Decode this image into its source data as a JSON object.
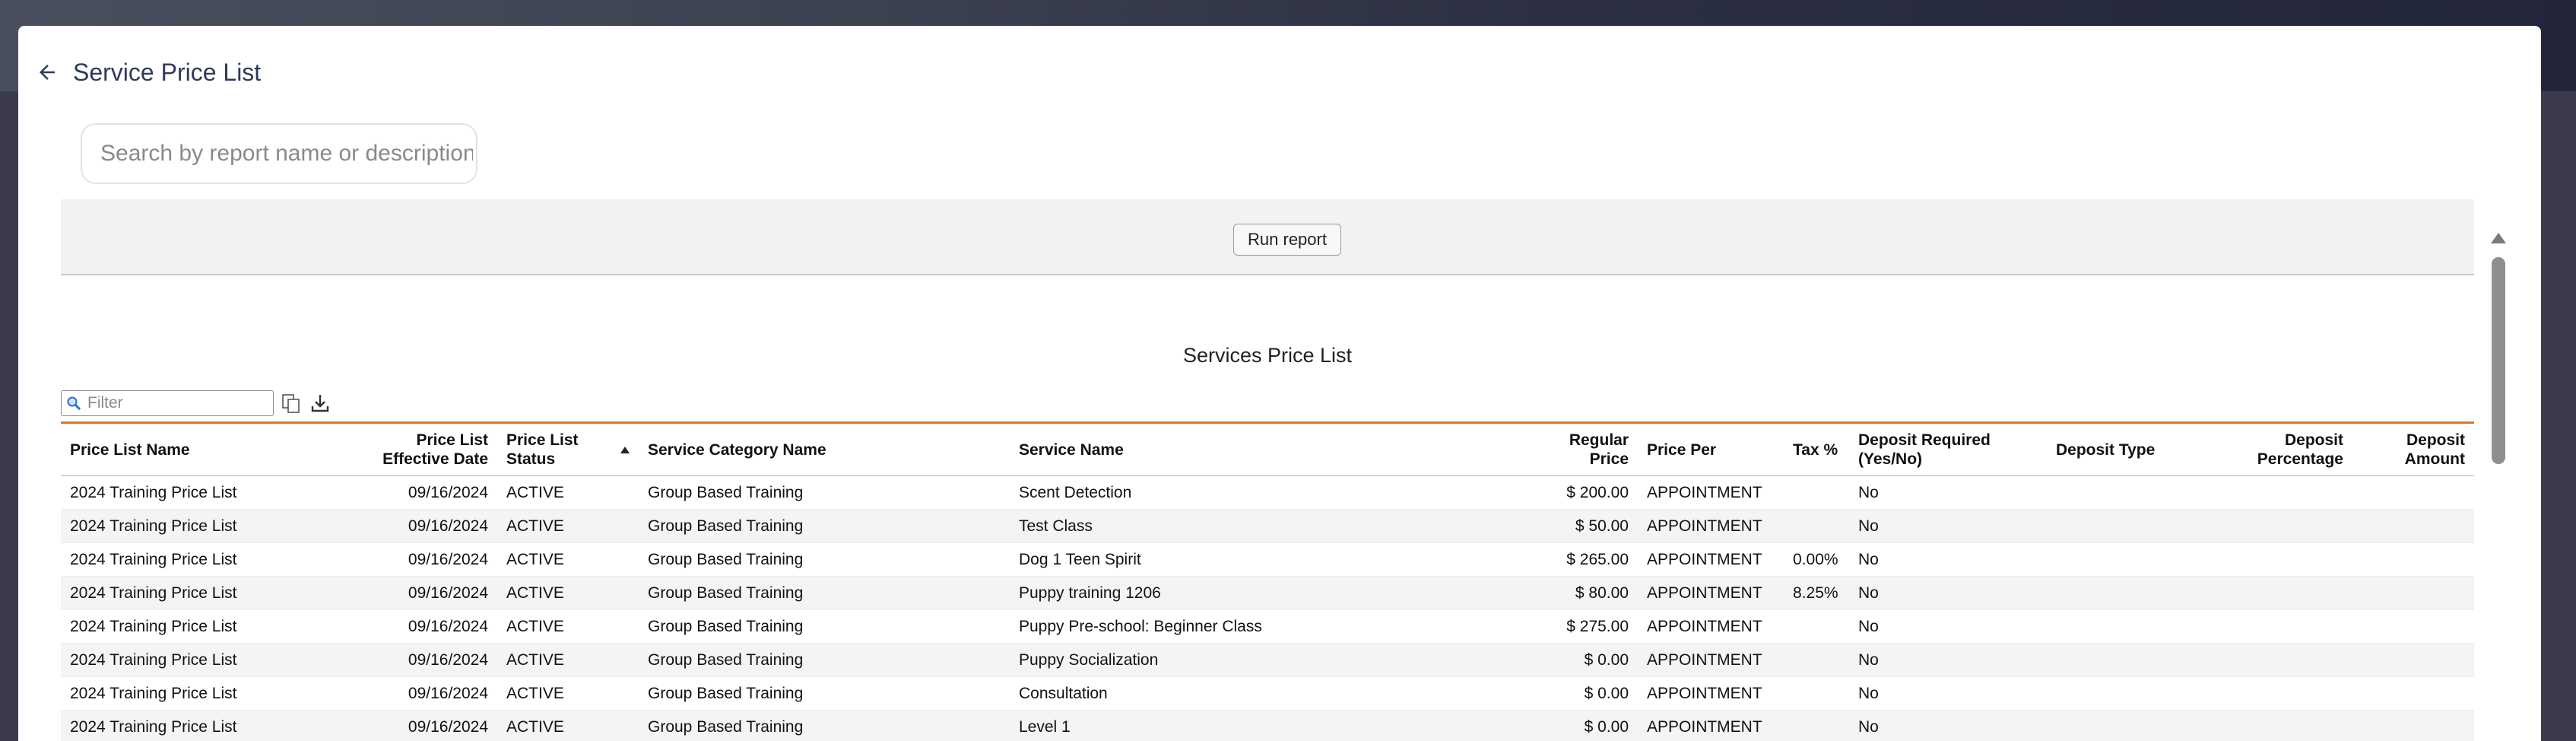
{
  "page": {
    "title": "Service Price List",
    "search_placeholder": "Search by report name or description"
  },
  "report": {
    "run_label": "Run report",
    "title": "Services Price List",
    "filter_placeholder": "Filter",
    "accent_color": "#e8731e",
    "icons": [
      "copy-icon",
      "download-icon",
      "search-icon",
      "back-arrow-icon"
    ]
  },
  "table": {
    "columns": [
      "Price List Name",
      "Price List Effective Date",
      "Price List Status",
      "Service Category Name",
      "Service Name",
      "Regular Price",
      "Price Per",
      "Tax %",
      "Deposit Required (Yes/No)",
      "Deposit Type",
      "Deposit Percentage",
      "Deposit Amount"
    ],
    "rows": [
      [
        "2024 Training Price List",
        "09/16/2024",
        "ACTIVE",
        "Group Based Training",
        "Scent Detection",
        "$ 200.00",
        "APPOINTMENT",
        "",
        "No",
        "",
        "",
        ""
      ],
      [
        "2024 Training Price List",
        "09/16/2024",
        "ACTIVE",
        "Group Based Training",
        "Test Class",
        "$ 50.00",
        "APPOINTMENT",
        "",
        "No",
        "",
        "",
        ""
      ],
      [
        "2024 Training Price List",
        "09/16/2024",
        "ACTIVE",
        "Group Based Training",
        "Dog 1 Teen Spirit",
        "$ 265.00",
        "APPOINTMENT",
        "0.00%",
        "No",
        "",
        "",
        ""
      ],
      [
        "2024 Training Price List",
        "09/16/2024",
        "ACTIVE",
        "Group Based Training",
        "Puppy training 1206",
        "$ 80.00",
        "APPOINTMENT",
        "8.25%",
        "No",
        "",
        "",
        ""
      ],
      [
        "2024 Training Price List",
        "09/16/2024",
        "ACTIVE",
        "Group Based Training",
        "Puppy Pre-school: Beginner Class",
        "$ 275.00",
        "APPOINTMENT",
        "",
        "No",
        "",
        "",
        ""
      ],
      [
        "2024 Training Price List",
        "09/16/2024",
        "ACTIVE",
        "Group Based Training",
        "Puppy Socialization",
        "$ 0.00",
        "APPOINTMENT",
        "",
        "No",
        "",
        "",
        ""
      ],
      [
        "2024 Training Price List",
        "09/16/2024",
        "ACTIVE",
        "Group Based Training",
        "Consultation",
        "$ 0.00",
        "APPOINTMENT",
        "",
        "No",
        "",
        "",
        ""
      ],
      [
        "2024 Training Price List",
        "09/16/2024",
        "ACTIVE",
        "Group Based Training",
        "Level 1",
        "$ 0.00",
        "APPOINTMENT",
        "",
        "No",
        "",
        "",
        ""
      ]
    ]
  }
}
